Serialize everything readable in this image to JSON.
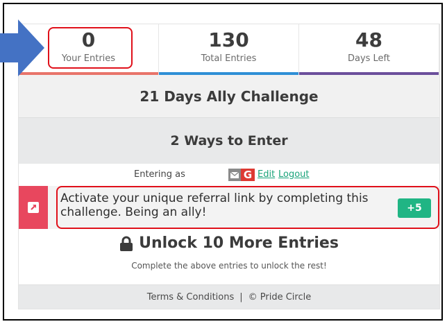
{
  "stats": [
    {
      "value": "0",
      "label": "Your Entries",
      "color": "#e8746a"
    },
    {
      "value": "130",
      "label": "Total Entries",
      "color": "#2e8fd6"
    },
    {
      "value": "48",
      "label": "Days Left",
      "color": "#6b4f9b"
    }
  ],
  "challenge_title": "21 Days Ally Challenge",
  "ways_title": "2 Ways to Enter",
  "entering": {
    "label": "Entering as",
    "provider_letter": "G",
    "edit_label": "Edit",
    "logout_label": "Logout"
  },
  "entry": {
    "text": "Activate your unique referral link by completing this challenge. Being an ally!",
    "points": "+5",
    "side_color": "#e8475e",
    "points_color": "#20b584"
  },
  "unlock": {
    "title": "Unlock 10 More Entries",
    "subtitle": "Complete the above entries to unlock the rest!"
  },
  "footer": {
    "terms_label": "Terms & Conditions",
    "separator": "|",
    "copyright": "© Pride Circle"
  },
  "annotation": {
    "highlight_color": "#e0101a",
    "arrow_color": "#4472c4"
  }
}
